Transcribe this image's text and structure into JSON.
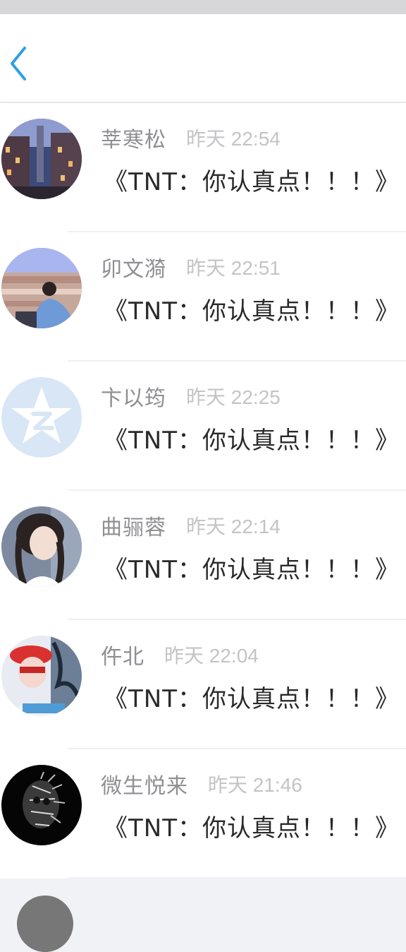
{
  "nav": {
    "back_icon": "chevron-left-icon",
    "accent": "#2f9ee8"
  },
  "items": [
    {
      "name": "莘寒松",
      "time": "昨天 22:54",
      "message": "《TNT：你认真点！！！》",
      "avatar": "city-night-icon"
    },
    {
      "name": "卯文漪",
      "time": "昨天 22:51",
      "message": "《TNT：你认真点！！！》",
      "avatar": "boy-cityscape-icon"
    },
    {
      "name": "卞以筠",
      "time": "昨天 22:25",
      "message": "《TNT：你认真点！！！》",
      "avatar": "qzone-star-icon"
    },
    {
      "name": "曲骊蓉",
      "time": "昨天 22:14",
      "message": "《TNT：你认真点！！！》",
      "avatar": "girl-braids-icon"
    },
    {
      "name": "仵北",
      "time": "昨天 22:04",
      "message": "《TNT：你认真点！！！》",
      "avatar": "girl-red-hat-icon"
    },
    {
      "name": "微生悦来",
      "time": "昨天 21:46",
      "message": "《TNT：你认真点！！！》",
      "avatar": "dark-skull-icon"
    }
  ]
}
